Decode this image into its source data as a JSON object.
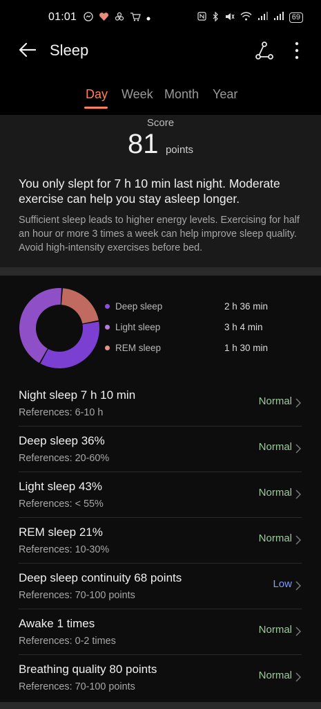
{
  "status_bar": {
    "time": "01:01",
    "left_icons": [
      "messenger-icon",
      "heart-icon",
      "game-icon",
      "cart-icon",
      "dot-icon"
    ],
    "right_icons": [
      "nfc-icon",
      "bluetooth-icon",
      "mute-icon",
      "wifi-icon",
      "signal-icon",
      "signal-icon"
    ],
    "battery": "69"
  },
  "app_bar": {
    "title": "Sleep"
  },
  "tabs": [
    {
      "label": "Day",
      "active": true
    },
    {
      "label": "Week",
      "active": false
    },
    {
      "label": "Month",
      "active": false
    },
    {
      "label": "Year",
      "active": false
    }
  ],
  "score": {
    "label": "Score",
    "value": "81",
    "unit": "points",
    "message": "You only slept for 7 h 10 min last night. Moderate exercise can help you stay asleep longer.",
    "detail": "Sufficient sleep leads to higher energy levels. Exercising for half an hour or more 3 times a week can help improve sleep quality. Avoid high-intensity exercises before bed."
  },
  "breakdown": {
    "segments": [
      {
        "name": "Deep sleep",
        "value": "2 h 36 min",
        "percent": 36,
        "color": "#7b3fd1"
      },
      {
        "name": "Light sleep",
        "value": "3 h 4 min",
        "percent": 43,
        "color": "#8f4fc6"
      },
      {
        "name": "REM sleep",
        "value": "1 h 30 min",
        "percent": 21,
        "color": "#c06a60"
      }
    ]
  },
  "metrics": [
    {
      "title": "Night sleep  7 h 10 min",
      "ref": "References: 6-10 h",
      "status": "Normal",
      "low": false
    },
    {
      "title": "Deep sleep  36%",
      "ref": "References: 20-60%",
      "status": "Normal",
      "low": false
    },
    {
      "title": "Light sleep  43%",
      "ref": "References: < 55%",
      "status": "Normal",
      "low": false
    },
    {
      "title": "REM sleep  21%",
      "ref": "References: 10-30%",
      "status": "Normal",
      "low": false
    },
    {
      "title": "Deep sleep continuity  68 points",
      "ref": "References: 70-100 points",
      "status": "Low",
      "low": true
    },
    {
      "title": "Awake  1 times",
      "ref": "References: 0-2 times",
      "status": "Normal",
      "low": false
    },
    {
      "title": "Breathing quality  80 points",
      "ref": "References: 70-100 points",
      "status": "Normal",
      "low": false
    }
  ]
}
